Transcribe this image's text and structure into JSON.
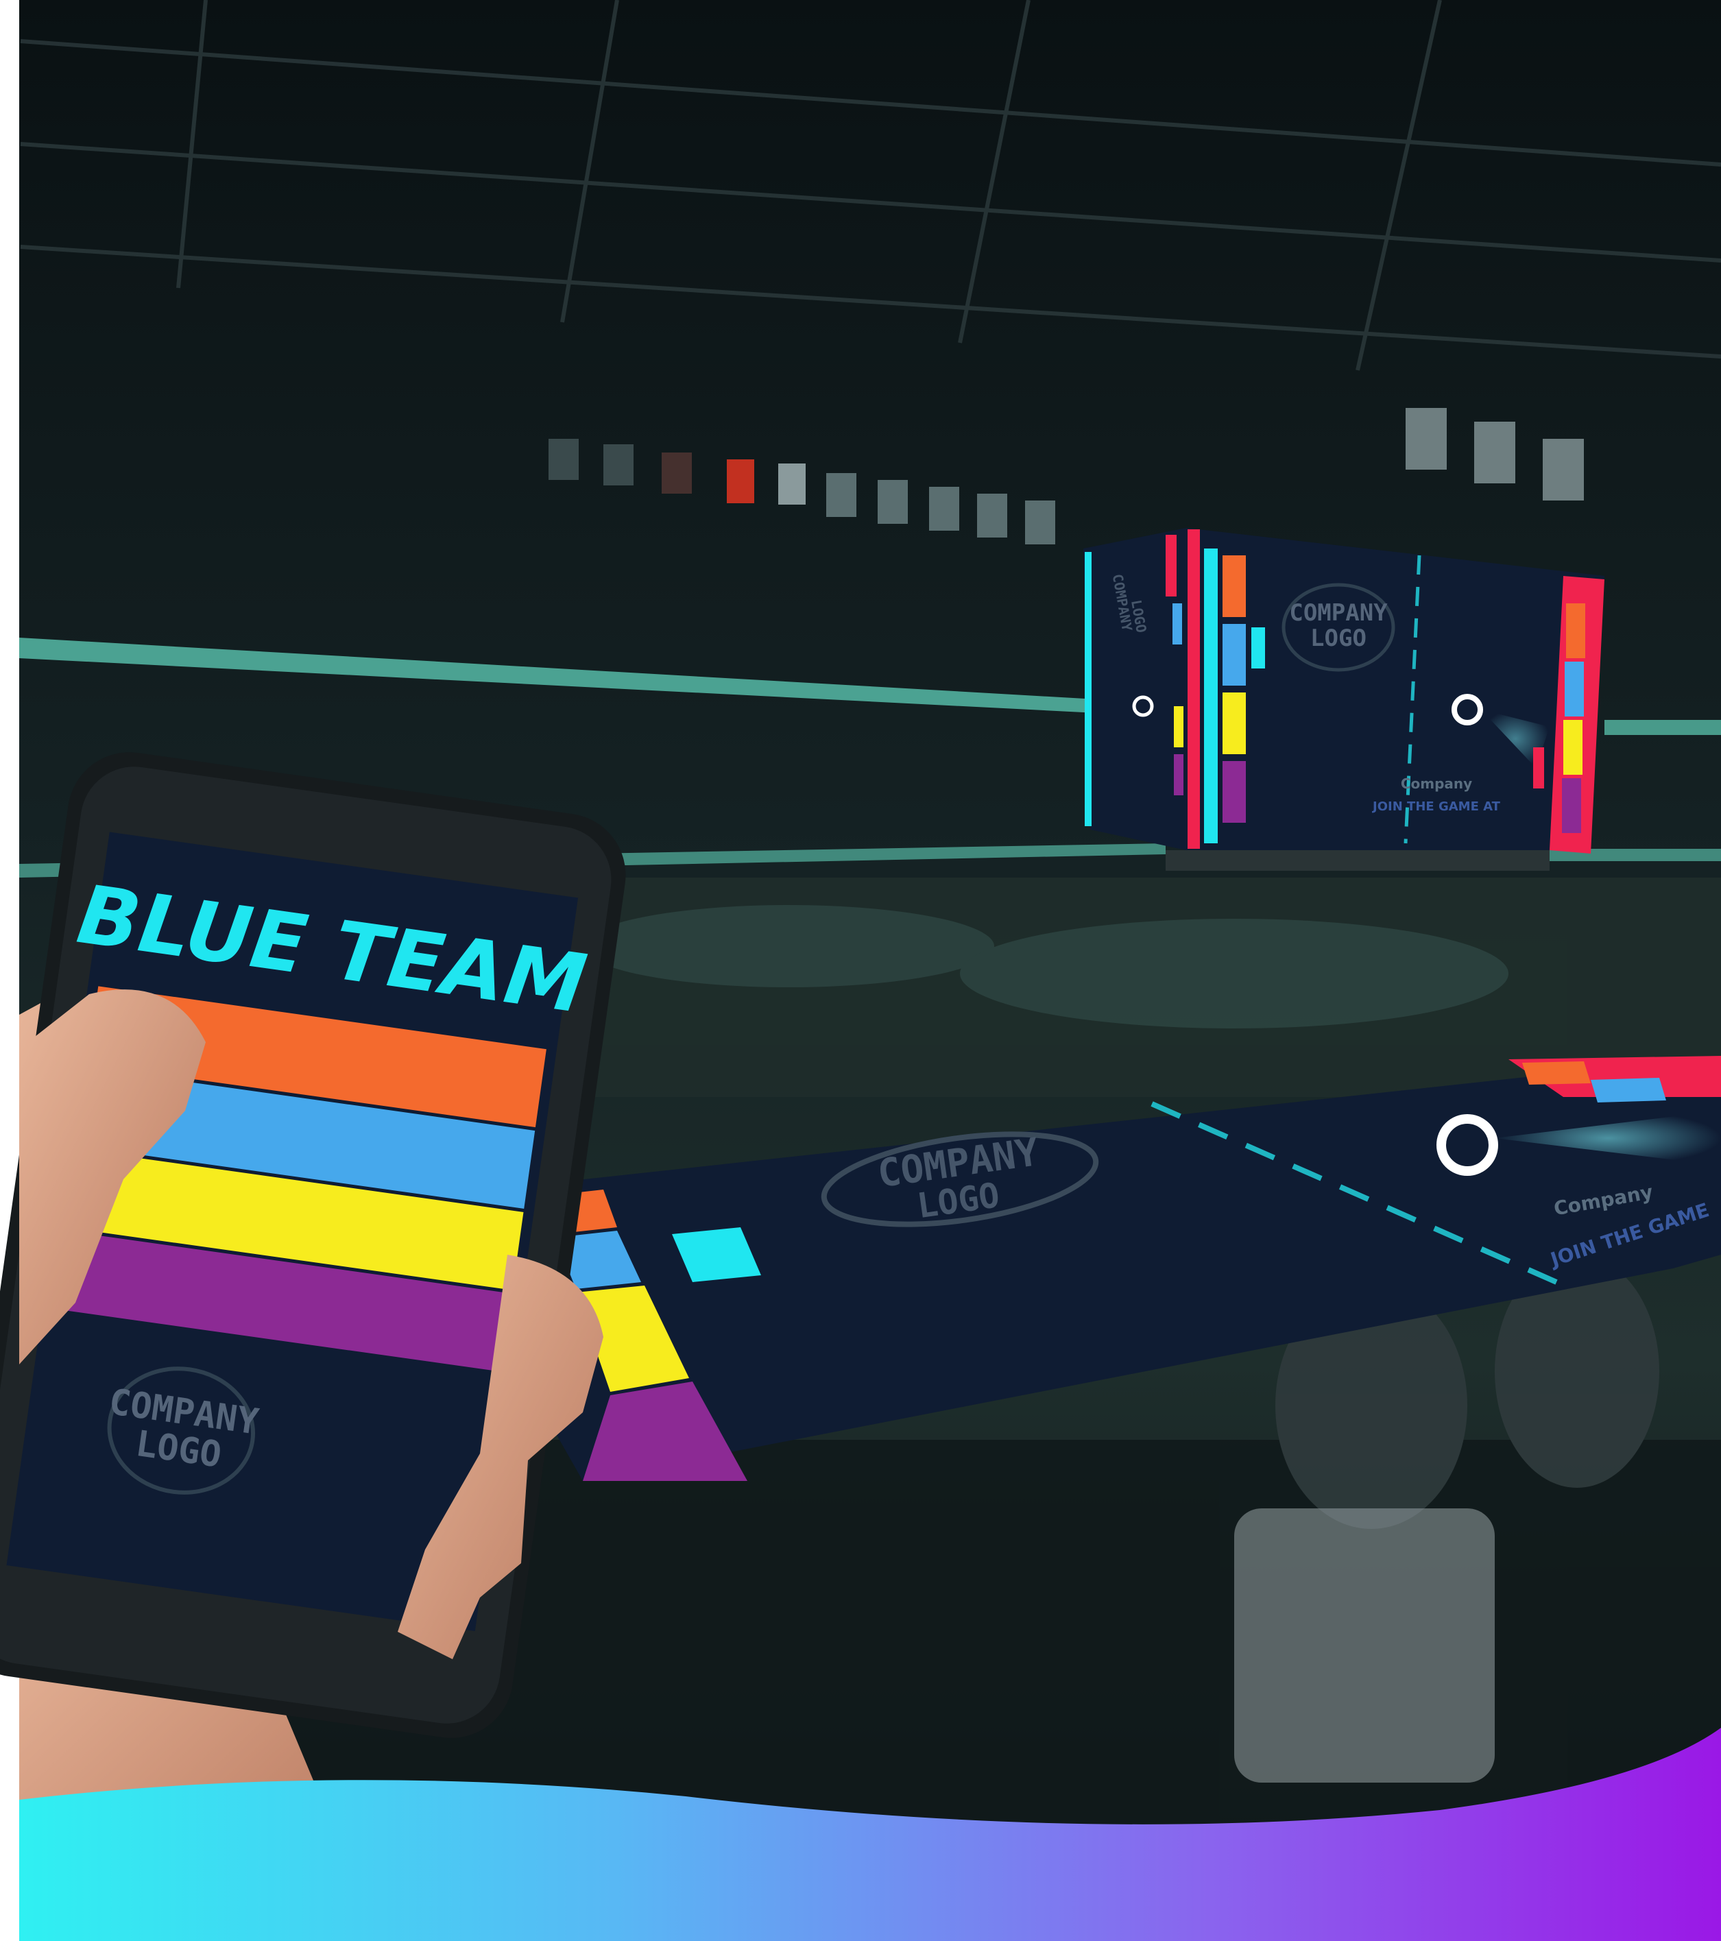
{
  "phone": {
    "team_title": "BLUE TEAM",
    "logo_line1": "COMPANY",
    "logo_line2": "LOGO"
  },
  "jumbotron": {
    "logo_line1": "COMPANY",
    "logo_line2": "LOGO",
    "side_logo_line1": "COMPANY",
    "side_logo_line2": "LOGO",
    "tagline": "JOIN THE GAME AT",
    "brand": "Company"
  },
  "ice": {
    "logo_line1": "COMPANY",
    "logo_line2": "LOGO",
    "brand": "Company",
    "tagline": "JOIN THE GAME"
  },
  "colors": {
    "background": "#0b1416",
    "screen": "#0f1c33",
    "cyan": "#20e6f0",
    "orange": "#f46a2e",
    "sky": "#46a8ec",
    "yellow": "#f7ec1e",
    "purple": "#8c2a94",
    "red": "#f0234e",
    "banner": "#7a2fd8"
  }
}
